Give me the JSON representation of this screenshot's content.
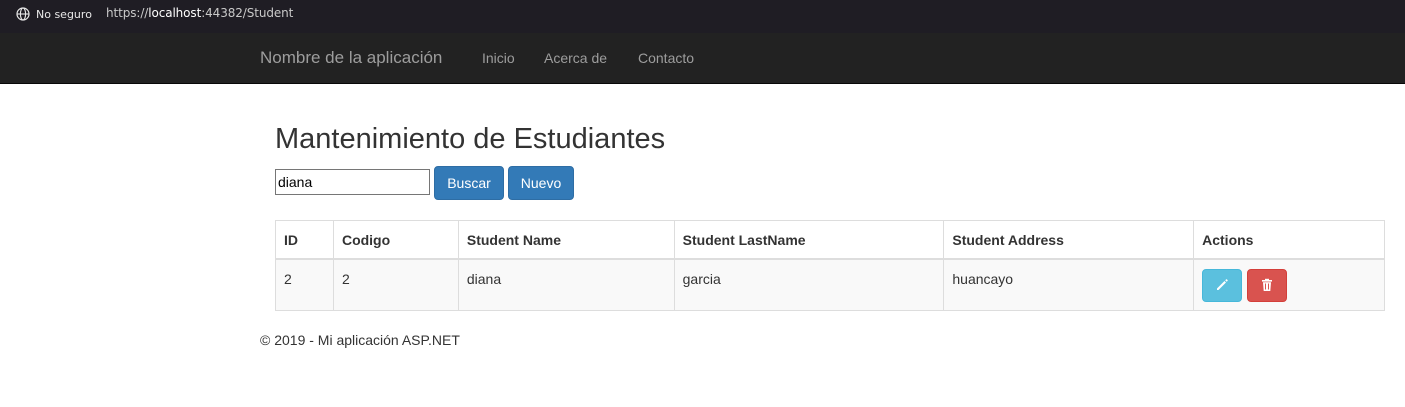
{
  "browser": {
    "security_label": "No seguro",
    "url_scheme": "https://",
    "url_host": "localhost",
    "url_rest": ":44382/Student"
  },
  "navbar": {
    "brand": "Nombre de la aplicación",
    "links": [
      "Inicio",
      "Acerca de",
      "Contacto"
    ]
  },
  "page": {
    "title": "Mantenimiento de Estudiantes",
    "search_value": "diana",
    "search_button": "Buscar",
    "new_button": "Nuevo"
  },
  "table": {
    "headers": [
      "ID",
      "Codigo",
      "Student Name",
      "Student LastName",
      "Student Address",
      "Actions"
    ],
    "rows": [
      {
        "id": "2",
        "codigo": "2",
        "name": "diana",
        "lastname": "garcia",
        "address": "huancayo",
        "actions": [
          "pencil-icon",
          "trash-icon"
        ]
      }
    ]
  },
  "footer": {
    "text": "© 2019 - Mi aplicación ASP.NET"
  },
  "colors": {
    "navbar_bg": "#222222",
    "primary": "#337ab7",
    "info": "#5bc0de",
    "danger": "#d9534f"
  }
}
